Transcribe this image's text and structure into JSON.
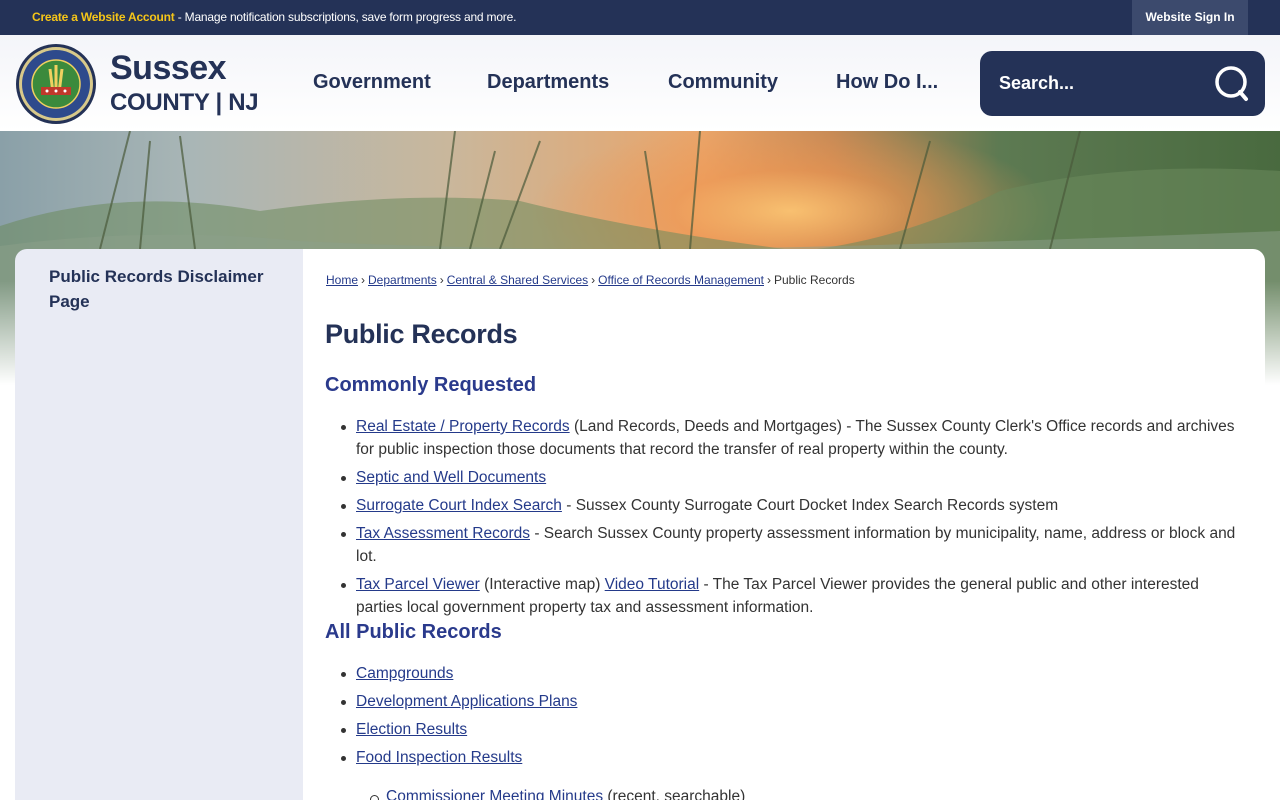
{
  "topbar": {
    "create_label": "Create a Website Account",
    "message": " - Manage notification subscriptions, save form progress and more.",
    "signin_label": "Website Sign In"
  },
  "logo": {
    "line1": "Sussex",
    "line2": "COUNTY | NJ",
    "seal_top": "SUSSEX COUNTY",
    "seal_bottom": "NEW JERSEY"
  },
  "nav": {
    "items": [
      "Government",
      "Departments",
      "Community",
      "How Do I..."
    ]
  },
  "search": {
    "placeholder": "Search..."
  },
  "sidebar": {
    "link": "Public Records Disclaimer Page"
  },
  "breadcrumb": {
    "items": [
      "Home",
      "Departments",
      "Central & Shared Services",
      "Office of Records Management"
    ],
    "current": "Public Records",
    "separator": "›"
  },
  "main": {
    "title": "Public Records",
    "section1": {
      "heading": "Commonly Requested",
      "items": [
        {
          "link": "Real Estate / Property Records",
          "text": " (Land Records, Deeds and Mortgages) - The Sussex County Clerk's Office records and archives for public inspection those documents that record the transfer of real property within the county."
        },
        {
          "link": "Septic and Well Documents",
          "text": ""
        },
        {
          "link": "Surrogate Court Index Search",
          "text": " - Sussex County Surrogate Court Docket Index Search Records system"
        },
        {
          "link": "Tax Assessment Records",
          "text": " - Search Sussex County property assessment information by municipality, name, address or block and lot."
        },
        {
          "link": "Tax Parcel Viewer",
          "text": " (Interactive map) ",
          "link2": "Video Tutorial",
          "text2": " - The Tax Parcel Viewer provides the general public and other interested parties local government property tax and assessment information."
        }
      ]
    },
    "section2": {
      "heading": "All Public Records",
      "items": [
        {
          "link": "Campgrounds"
        },
        {
          "link": "Development Applications Plans"
        },
        {
          "link": "Election Results"
        },
        {
          "link": "Food Inspection Results"
        }
      ],
      "subitems": [
        {
          "link": "Commissioner Meeting Minutes",
          "text": " (recent, searchable)"
        }
      ]
    }
  },
  "colors": {
    "navy": "#243257",
    "link": "#243a8a",
    "accent_yellow": "#f5c518"
  }
}
